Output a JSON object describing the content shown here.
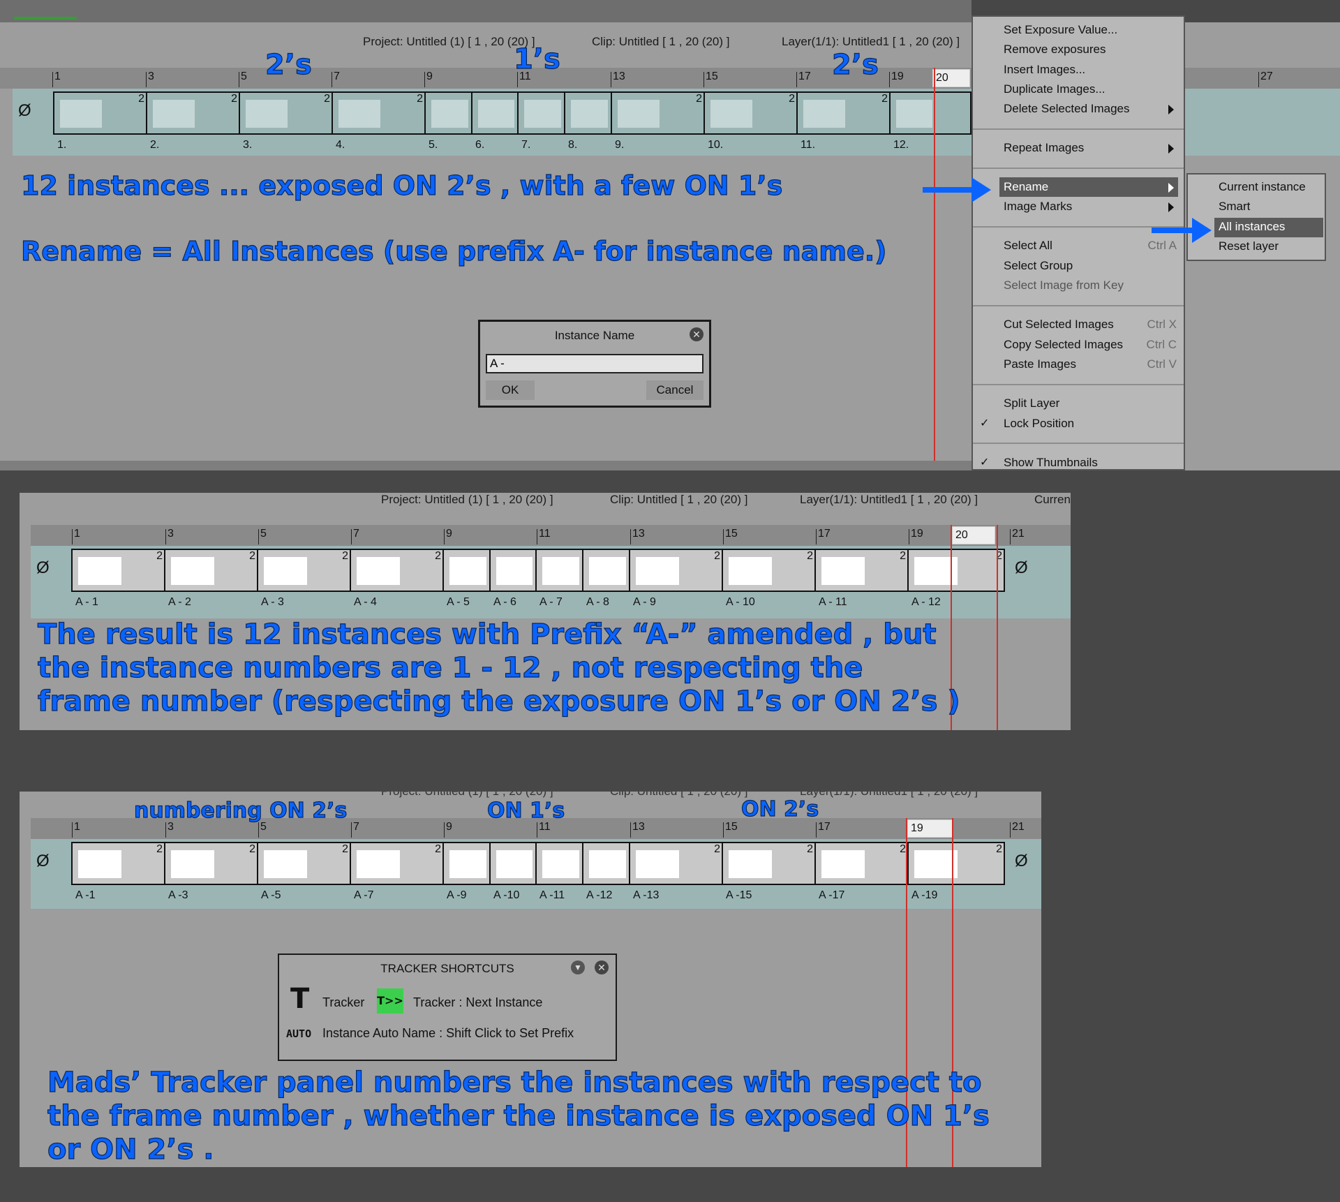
{
  "info": {
    "project": "Project: Untitled (1) [ 1 , 20  (20) ]",
    "clip": "Clip: Untitled [ 1 , 20  (20) ]",
    "layer": "Layer(1/1): Untitled1 [ 1 , 20  (20) ]",
    "layer_short": "Layer(1/1): Untitled1 [ 1 , 20  (20)",
    "current": "Curren"
  },
  "ruler": {
    "numbers": [
      "1",
      "3",
      "5",
      "7",
      "9",
      "11",
      "13",
      "15",
      "17",
      "19",
      "21"
    ],
    "number_27": "27",
    "current_frame_1": "20",
    "current_frame_2": "20",
    "current_frame_3": "19"
  },
  "track1": {
    "labels": [
      "1.",
      "2.",
      "3.",
      "4.",
      "5.",
      "6.",
      "7.",
      "8.",
      "9.",
      "10.",
      "11.",
      "12."
    ],
    "two": "2",
    "empty_icon": "Ø"
  },
  "track2": {
    "labels": [
      "A - 1",
      "A - 2",
      "A - 3",
      "A - 4",
      "A - 5",
      "A - 6",
      "A - 7",
      "A - 8",
      "A - 9",
      "A - 10",
      "A - 11",
      "A - 12"
    ]
  },
  "track3": {
    "labels": [
      "A -1",
      "A -3",
      "A -5",
      "A -7",
      "A -9",
      "A -10",
      "A -11",
      "A -12",
      "A -13",
      "A -15",
      "A -17",
      "A -19"
    ]
  },
  "annotations": {
    "p1_twos_a": "2’s",
    "p1_ones": "1’s",
    "p1_twos_b": "2’s",
    "p1_line1": "12 instances  ... exposed ON 2’s , with a few ON 1’s",
    "p1_line2": "Rename = All Instances   (use prefix  A- for instance name.)",
    "p2_line1": "The result is 12 instances with Prefix “A-” amended , but",
    "p2_line2": "the instance numbers are 1 - 12 , not respecting the",
    "p2_line3": "frame number (respecting the exposure ON 1’s or  ON 2’s )",
    "p3_twos_a": "numbering ON 2’s",
    "p3_ones": "ON 1’s",
    "p3_twos_b": "ON 2’s",
    "p3_line1": "Mads’ Tracker panel numbers the instances with respect to",
    "p3_line2": "the frame number , whether the instance is exposed ON 1’s",
    "p3_line3": "or ON 2’s ."
  },
  "context_menu": {
    "items": [
      {
        "label": "Set Exposure Value...",
        "shortcut": ""
      },
      {
        "label": "Remove exposures",
        "shortcut": ""
      },
      {
        "label": "Insert Images...",
        "shortcut": ""
      },
      {
        "label": "Duplicate Images...",
        "shortcut": ""
      },
      {
        "label": "Delete Selected Images",
        "shortcut": ""
      },
      {
        "label": "Repeat Images",
        "shortcut": ""
      },
      {
        "label": "Rename",
        "shortcut": ""
      },
      {
        "label": "Image Marks",
        "shortcut": ""
      },
      {
        "label": "Select All",
        "shortcut": "Ctrl A"
      },
      {
        "label": "Select Group",
        "shortcut": ""
      },
      {
        "label": "Select Image from Key",
        "shortcut": ""
      },
      {
        "label": "Cut Selected Images",
        "shortcut": "Ctrl X"
      },
      {
        "label": "Copy Selected Images",
        "shortcut": "Ctrl C"
      },
      {
        "label": "Paste Images",
        "shortcut": "Ctrl V"
      },
      {
        "label": "Split Layer",
        "shortcut": ""
      },
      {
        "label": "Lock Position",
        "shortcut": ""
      },
      {
        "label": "Show Thumbnails",
        "shortcut": ""
      }
    ],
    "checkmark": "✓"
  },
  "rename_submenu": [
    "Current instance",
    "Smart",
    "All instances",
    "Reset layer"
  ],
  "dialog": {
    "title": "Instance Name",
    "value": "A -",
    "ok": "OK",
    "cancel": "Cancel"
  },
  "tracker": {
    "title": "TRACKER SHORTCUTS",
    "tracker_label": "Tracker",
    "next_label": "Tracker : Next Instance",
    "auto_icon": "AUTO",
    "auto_label": "Instance Auto Name : Shift Click to Set Prefix",
    "t_icon": "T",
    "t_next_icon": "T>>"
  },
  "colors": {
    "annotation": "#0a63ff",
    "highlight": "#5a5a5a",
    "playhead": "#d0302a",
    "track": "#9bb5b5",
    "tracker_green": "#3ccf4e"
  }
}
